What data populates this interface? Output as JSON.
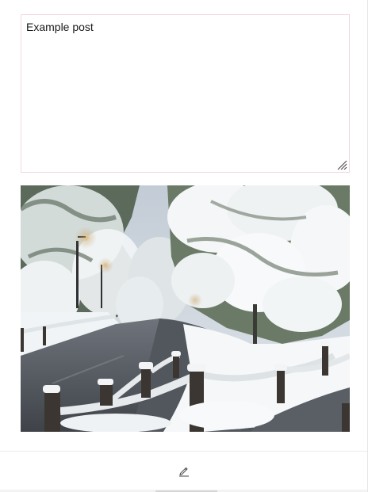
{
  "composer": {
    "post_text": "Example post"
  },
  "attachment": {
    "icon": "snowy-park-photo"
  },
  "footer": {
    "edit_icon": "pencil-icon"
  },
  "colors": {
    "textarea_border": "#f1d8dc",
    "icon_stroke": "#555555"
  }
}
